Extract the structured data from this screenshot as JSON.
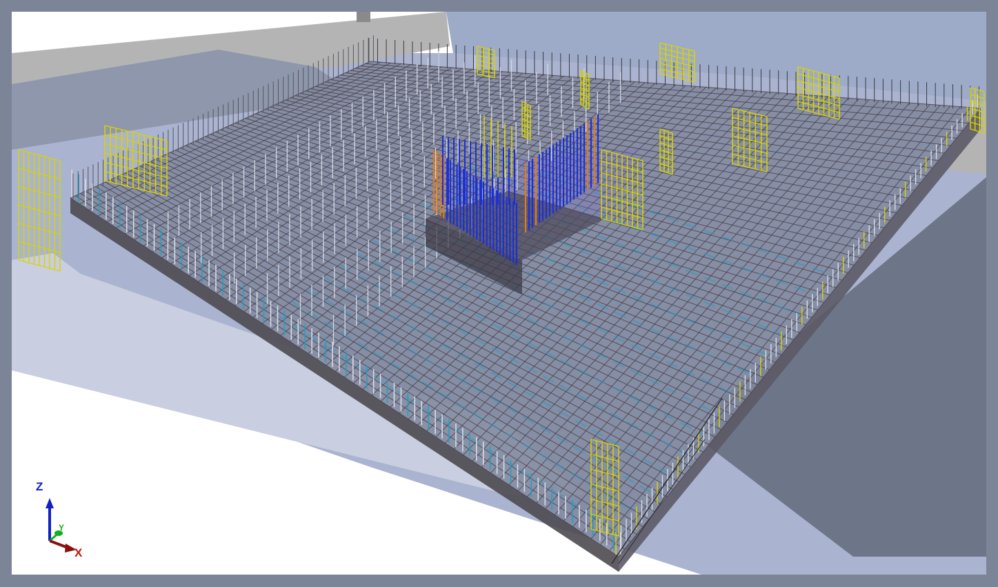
{
  "viewport": {
    "label": "3D model view",
    "background": "#ffffff"
  },
  "scene": {
    "colors": {
      "ground": "#aab3cf",
      "shadow": "#6d7689",
      "buildings_light": "#b4b4b4",
      "buildings_dark": "#8e97ab",
      "slab_top": "#7f879d",
      "slab_side": "#4d4a50",
      "rebar_dark": "#4a3c44",
      "rebar_grey": "#d8dce6",
      "rebar_cyan": "#2a9cc0",
      "rebar_yellow": "#d8d400",
      "rebar_blue": "#1c2fd6",
      "rebar_orange": "#e07a20",
      "rebar_red": "#a0301c",
      "rebar_purple": "#7b6cc8"
    }
  },
  "axis_triad": {
    "z_label": "Z",
    "y_label": "Y",
    "x_label": "X",
    "z_color": "#1020c0",
    "y_color": "#10b020",
    "x_color": "#d01010",
    "x_arrow_color": "#8a1010"
  }
}
